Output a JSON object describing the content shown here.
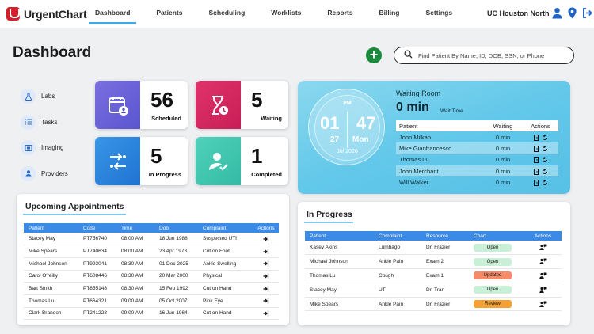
{
  "app": {
    "name": "UrgentChart",
    "brand_color": "#d4202d",
    "accent_color": "#3fa9e6"
  },
  "nav": {
    "items": [
      {
        "label": "Dashboard",
        "active": true
      },
      {
        "label": "Patients"
      },
      {
        "label": "Scheduling"
      },
      {
        "label": "Worklists"
      },
      {
        "label": "Reports"
      },
      {
        "label": "Billing"
      },
      {
        "label": "Settings"
      }
    ],
    "location": "UC Houston North",
    "icons": [
      "user-icon",
      "location-pin-icon",
      "logout-icon"
    ]
  },
  "page": {
    "title": "Dashboard"
  },
  "search": {
    "placeholder": "Find Patient By Name, ID, DOB, SSN, or Phone"
  },
  "quick_links": [
    {
      "label": "Labs",
      "icon": "flask-icon"
    },
    {
      "label": "Tasks",
      "icon": "list-icon"
    },
    {
      "label": "Imaging",
      "icon": "image-icon"
    },
    {
      "label": "Providers",
      "icon": "person-icon"
    }
  ],
  "stats": {
    "scheduled": {
      "value": "56",
      "label": "Scheduled",
      "color": "#6b63d9",
      "icon": "calendar-user-icon"
    },
    "waiting": {
      "value": "5",
      "label": "Waiting",
      "color": "#d8245f",
      "icon": "hourglass-icon"
    },
    "in_progress": {
      "value": "5",
      "label": "In Progress",
      "color": "#2a84de",
      "icon": "route-icon"
    },
    "completed": {
      "value": "1",
      "label": "Completed",
      "color": "#3ec6b0",
      "icon": "user-check-icon"
    }
  },
  "waiting_room": {
    "title": "Waiting Room",
    "wait_time": "0 min",
    "wait_time_label": "Wait Time",
    "clock": {
      "ampm": "PM",
      "hour": "01",
      "minute": "47",
      "day": "27",
      "weekday": "Mon",
      "date": "Jul 2026"
    },
    "columns": [
      "Patient",
      "Waiting",
      "Actions"
    ],
    "rows": [
      {
        "patient": "John Milkan",
        "waiting": "0 min"
      },
      {
        "patient": "Mike Gianfrancesco",
        "waiting": "0 min"
      },
      {
        "patient": "Thomas Lu",
        "waiting": "0 min"
      },
      {
        "patient": "John Merchant",
        "waiting": "0 min"
      },
      {
        "patient": "Will Walker",
        "waiting": "0 min"
      }
    ]
  },
  "upcoming": {
    "title": "Upcoming Appointments",
    "columns": [
      "Patient",
      "Code",
      "Time",
      "Dob",
      "Complaint",
      "Actions"
    ],
    "rows": [
      {
        "patient": "Stacey May",
        "code": "PT756740",
        "time": "08:00 AM",
        "dob": "18 Jun 1988",
        "complaint": "Suspected UTI"
      },
      {
        "patient": "Mike Spears",
        "code": "PT740634",
        "time": "08:00 AM",
        "dob": "23 Apr 1973",
        "complaint": "Cut on Foot"
      },
      {
        "patient": "Michael Johnson",
        "code": "PT993041",
        "time": "08:30 AM",
        "dob": "01 Dec 2025",
        "complaint": "Ankle Swelling"
      },
      {
        "patient": "Carol O'reilly",
        "code": "PT608446",
        "time": "08:30 AM",
        "dob": "20 Mar 2000",
        "complaint": "Physical"
      },
      {
        "patient": "Bart Smith",
        "code": "PT855148",
        "time": "08:30 AM",
        "dob": "15 Feb 1992",
        "complaint": "Cut on Hand"
      },
      {
        "patient": "Thomas Lu",
        "code": "PT664321",
        "time": "09:00 AM",
        "dob": "05 Oct 2007",
        "complaint": "Pink Eye"
      },
      {
        "patient": "Clark Brandon",
        "code": "PT241228",
        "time": "09:00 AM",
        "dob": "16 Jun 1964",
        "complaint": "Cut on Hand"
      }
    ]
  },
  "in_progress": {
    "title": "In Progress",
    "columns": [
      "Patient",
      "Complaint",
      "Resource",
      "Chart",
      "Actions"
    ],
    "rows": [
      {
        "patient": "Kasey Akins",
        "complaint": "Lumbago",
        "resource": "Dr. Frazier",
        "chart": "Open",
        "chart_color": "#c9efd6"
      },
      {
        "patient": "Michael Johnson",
        "complaint": "Ankle Pain",
        "resource": "Exam 2",
        "chart": "Open",
        "chart_color": "#c9efd6"
      },
      {
        "patient": "Thomas Lu",
        "complaint": "Cough",
        "resource": "Exam 1",
        "chart": "Updated",
        "chart_color": "#f48a68"
      },
      {
        "patient": "Stacey May",
        "complaint": "UTI",
        "resource": "Dr. Tran",
        "chart": "Open",
        "chart_color": "#c9efd6"
      },
      {
        "patient": "Mike Spears",
        "complaint": "Ankle Pain",
        "resource": "Dr. Frazier",
        "chart": "Review",
        "chart_color": "#f5a033"
      }
    ]
  }
}
